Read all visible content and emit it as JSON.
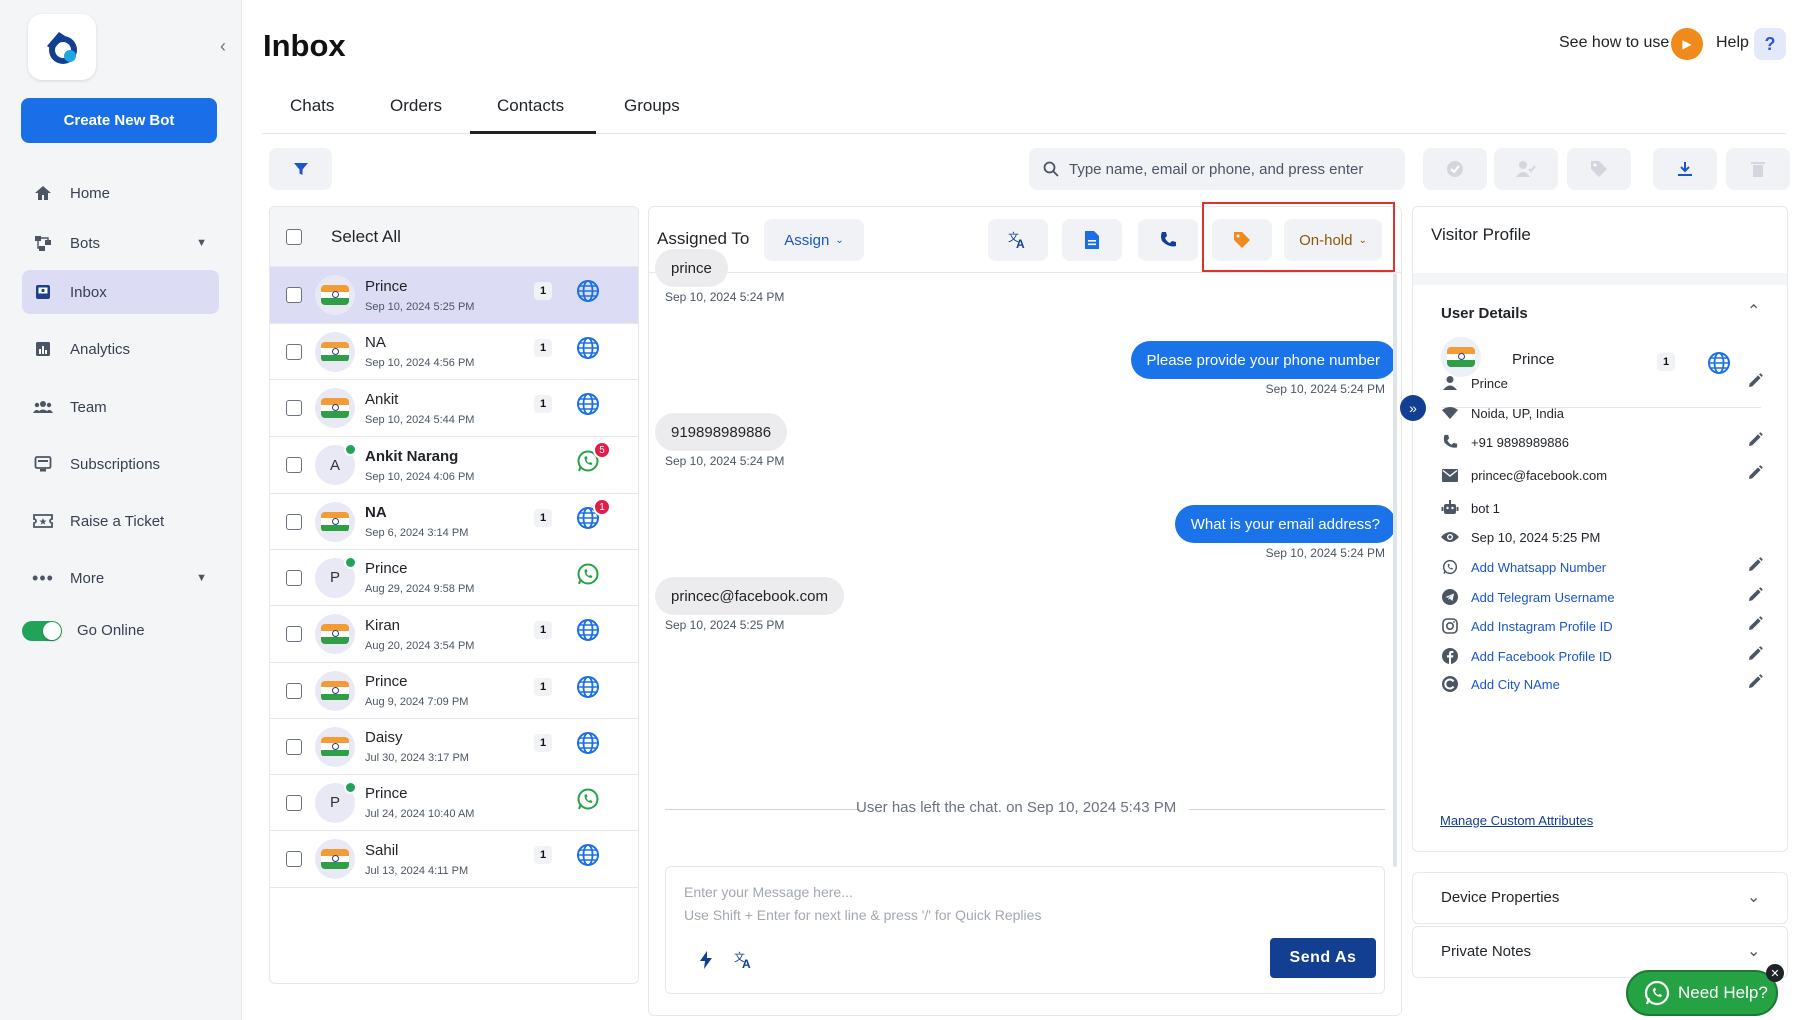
{
  "sidebar": {
    "create_bot": "Create New Bot",
    "items": [
      {
        "label": "Home",
        "icon": "home-icon"
      },
      {
        "label": "Bots",
        "icon": "bots-icon"
      },
      {
        "label": "Inbox",
        "icon": "inbox-icon"
      },
      {
        "label": "Analytics",
        "icon": "analytics-icon"
      },
      {
        "label": "Team",
        "icon": "team-icon"
      },
      {
        "label": "Subscriptions",
        "icon": "subscriptions-icon"
      },
      {
        "label": "Raise a Ticket",
        "icon": "ticket-icon"
      },
      {
        "label": "More",
        "icon": "more-icon"
      }
    ],
    "go_online": "Go Online",
    "go_online_on": true
  },
  "header": {
    "title": "Inbox",
    "see_how": "See how to use",
    "help": "Help",
    "help_symbol": "?"
  },
  "tabs": [
    {
      "label": "Chats"
    },
    {
      "label": "Orders"
    },
    {
      "label": "Contacts",
      "active": true
    },
    {
      "label": "Groups"
    }
  ],
  "search": {
    "placeholder": "Type name, email or phone, and press enter"
  },
  "contacts": {
    "select_all": "Select All",
    "rows": [
      {
        "name": "Prince",
        "date": "Sep 10, 2024 5:25 PM",
        "count": "1",
        "channel": "web",
        "avatar": "flag",
        "selected": true
      },
      {
        "name": "NA",
        "date": "Sep 10, 2024 4:56 PM",
        "count": "1",
        "channel": "web",
        "avatar": "flag"
      },
      {
        "name": "Ankit",
        "date": "Sep 10, 2024 5:44 PM",
        "count": "1",
        "channel": "web",
        "avatar": "flag"
      },
      {
        "name": "Ankit Narang",
        "date": "Sep 10, 2024 4:06 PM",
        "channel": "whatsapp",
        "avatar": "A",
        "online": true,
        "bold": true,
        "badge": "5"
      },
      {
        "name": "NA",
        "date": "Sep 6, 2024 3:14 PM",
        "count": "1",
        "channel": "web",
        "avatar": "flag",
        "bold": true,
        "badge": "1"
      },
      {
        "name": "Prince",
        "date": "Aug 29, 2024 9:58 PM",
        "channel": "whatsapp",
        "avatar": "P",
        "online": true
      },
      {
        "name": "Kiran",
        "date": "Aug 20, 2024 3:54 PM",
        "count": "1",
        "channel": "web",
        "avatar": "flag"
      },
      {
        "name": "Prince",
        "date": "Aug 9, 2024 7:09 PM",
        "count": "1",
        "channel": "web",
        "avatar": "flag"
      },
      {
        "name": "Daisy",
        "date": "Jul 30, 2024 3:17 PM",
        "count": "1",
        "channel": "web",
        "avatar": "flag"
      },
      {
        "name": "Prince",
        "date": "Jul 24, 2024 10:40 AM",
        "channel": "whatsapp",
        "avatar": "P",
        "online": true
      },
      {
        "name": "Sahil",
        "date": "Jul 13, 2024 4:11 PM",
        "count": "1",
        "channel": "web",
        "avatar": "flag"
      }
    ]
  },
  "chat": {
    "assigned_to": "Assigned To",
    "assign": "Assign",
    "status": "On-hold",
    "messages": [
      {
        "dir": "in",
        "text": "prince",
        "time": "Sep 10, 2024 5:24 PM"
      },
      {
        "dir": "out",
        "text": "Please provide your phone number",
        "time": "Sep 10, 2024 5:24 PM"
      },
      {
        "dir": "in",
        "text": "919898989886",
        "time": "Sep 10, 2024 5:24 PM"
      },
      {
        "dir": "out",
        "text": "What is your email address?",
        "time": "Sep 10, 2024 5:24 PM"
      },
      {
        "dir": "in",
        "text": "princec@facebook.com",
        "time": "Sep 10, 2024 5:25 PM"
      }
    ],
    "left_notice": "User has left the chat. on  Sep 10, 2024 5:43 PM",
    "composer_placeholder": "Enter your Message here...\nUse Shift + Enter for next line & press '/' for Quick Replies",
    "send_as": "Send As"
  },
  "profile": {
    "title": "Visitor Profile",
    "user_details": "User Details",
    "name": "Prince",
    "count": "1",
    "attributes": [
      {
        "icon": "person-icon",
        "text": "Prince",
        "editable": true
      },
      {
        "icon": "location-icon",
        "text": "Noida, UP, India",
        "editable": false
      },
      {
        "icon": "phone-icon",
        "text": "+91 9898989886",
        "editable": true
      },
      {
        "icon": "mail-icon",
        "text": "princec@facebook.com",
        "editable": true
      },
      {
        "icon": "bot-icon",
        "text": "bot 1",
        "editable": false
      },
      {
        "icon": "eye-icon",
        "text": "Sep 10, 2024 5:25 PM",
        "editable": false
      },
      {
        "icon": "whatsapp-icon",
        "text": "Add Whatsapp Number",
        "editable": true,
        "link": true
      },
      {
        "icon": "telegram-icon",
        "text": "Add Telegram Username",
        "editable": true,
        "link": true
      },
      {
        "icon": "instagram-icon",
        "text": "Add Instagram Profile ID",
        "editable": true,
        "link": true
      },
      {
        "icon": "facebook-icon",
        "text": "Add Facebook Profile ID",
        "editable": true,
        "link": true
      },
      {
        "icon": "city-icon",
        "text": "Add City NAme",
        "editable": true,
        "link": true
      }
    ],
    "manage_attributes": "Manage Custom Attributes",
    "device_properties": "Device Properties",
    "private_notes": "Private Notes"
  },
  "need_help": "Need Help?",
  "colors": {
    "primary": "#1a6fe8",
    "navy": "#123f91",
    "whatsapp": "#25a244",
    "highlight": "#e03131",
    "selected_row": "#dcdcf4"
  }
}
